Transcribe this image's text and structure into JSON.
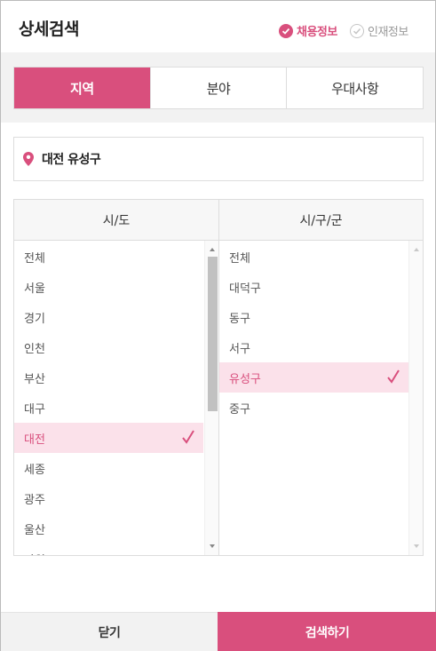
{
  "header": {
    "title": "상세검색",
    "toggle_active": "채용정보",
    "toggle_inactive": "인재정보"
  },
  "tabs": [
    "지역",
    "분야",
    "우대사항"
  ],
  "location": {
    "selected_text": "대전 유성구"
  },
  "columns": {
    "left_header": "시/도",
    "right_header": "시/구/군"
  },
  "left_list": [
    "전체",
    "서울",
    "경기",
    "인천",
    "부산",
    "대구",
    "대전",
    "세종",
    "광주",
    "울산",
    "강원"
  ],
  "left_selected_index": 6,
  "right_list": [
    "전체",
    "대덕구",
    "동구",
    "서구",
    "유성구",
    "중구"
  ],
  "right_selected_index": 4,
  "footer": {
    "close_label": "닫기",
    "search_label": "검색하기"
  },
  "colors": {
    "accent": "#d94f7d",
    "selected_bg": "#fbe1ea"
  },
  "icons": {
    "radio_checked": "check-circle-icon",
    "radio_unchecked": "check-circle-outline-icon",
    "location": "map-pin-icon",
    "selected": "checkmark-icon"
  }
}
